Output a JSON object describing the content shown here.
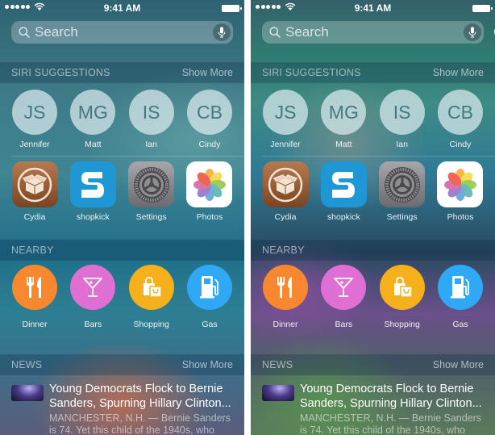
{
  "screens": [
    {
      "id": "left",
      "status_bar": {
        "time": "9:41 AM"
      },
      "search": {
        "placeholder": "Search",
        "value": "",
        "cancel_label": null
      },
      "siri_suggestions": {
        "title": "SIRI SUGGESTIONS",
        "show_more": "Show More",
        "contacts": [
          {
            "initials": "JS",
            "name": "Jennifer"
          },
          {
            "initials": "MG",
            "name": "Matt"
          },
          {
            "initials": "IS",
            "name": "Ian"
          },
          {
            "initials": "CB",
            "name": "Cindy"
          }
        ],
        "apps": [
          {
            "name": "Cydia",
            "icon": "cydia-icon"
          },
          {
            "name": "shopkick",
            "icon": "shopkick-icon"
          },
          {
            "name": "Settings",
            "icon": "settings-gear-icon"
          },
          {
            "name": "Photos",
            "icon": "photos-flower-icon"
          }
        ]
      },
      "nearby": {
        "title": "NEARBY",
        "items": [
          {
            "label": "Dinner",
            "icon": "fork-knife-icon",
            "color": "#f7882f"
          },
          {
            "label": "Bars",
            "icon": "cocktail-glass-icon",
            "color": "#e06fd4"
          },
          {
            "label": "Shopping",
            "icon": "shopping-bags-icon",
            "color": "#f5b01c"
          },
          {
            "label": "Gas",
            "icon": "gas-pump-icon",
            "color": "#2fa8f5"
          }
        ]
      },
      "news": {
        "title": "NEWS",
        "show_more": "Show More",
        "item": {
          "title": "Young Democrats Flock to Bernie Sanders, Spurning Hillary Clinton...",
          "snippet": "MANCHESTER, N.H. — Bernie Sanders is 74. Yet this child of the 1940s, who"
        }
      }
    },
    {
      "id": "right",
      "status_bar": {
        "time": "9:41 AM"
      },
      "search": {
        "placeholder": "Search",
        "value": "",
        "cancel_label": "Cancel"
      },
      "siri_suggestions": {
        "title": "SIRI SUGGESTIONS",
        "show_more": "Show More",
        "contacts": [
          {
            "initials": "JS",
            "name": "Jennifer"
          },
          {
            "initials": "MG",
            "name": "Matt"
          },
          {
            "initials": "IS",
            "name": "Ian"
          },
          {
            "initials": "CB",
            "name": "Cindy"
          }
        ],
        "apps": [
          {
            "name": "Cydia",
            "icon": "cydia-icon"
          },
          {
            "name": "shopkick",
            "icon": "shopkick-icon"
          },
          {
            "name": "Settings",
            "icon": "settings-gear-icon"
          },
          {
            "name": "Photos",
            "icon": "photos-flower-icon"
          }
        ]
      },
      "nearby": {
        "title": "NEARBY",
        "items": [
          {
            "label": "Dinner",
            "icon": "fork-knife-icon",
            "color": "#f7882f"
          },
          {
            "label": "Bars",
            "icon": "cocktail-glass-icon",
            "color": "#e06fd4"
          },
          {
            "label": "Shopping",
            "icon": "shopping-bags-icon",
            "color": "#f5b01c"
          },
          {
            "label": "Gas",
            "icon": "gas-pump-icon",
            "color": "#2fa8f5"
          }
        ]
      },
      "news": {
        "title": "NEWS",
        "show_more": "Show More",
        "item": {
          "title": "Young Democrats Flock to Bernie Sanders, Spurning Hillary Clinton...",
          "snippet": "MANCHESTER, N.H. — Bernie Sanders is 74. Yet this child of the 1940s, who"
        }
      }
    }
  ]
}
